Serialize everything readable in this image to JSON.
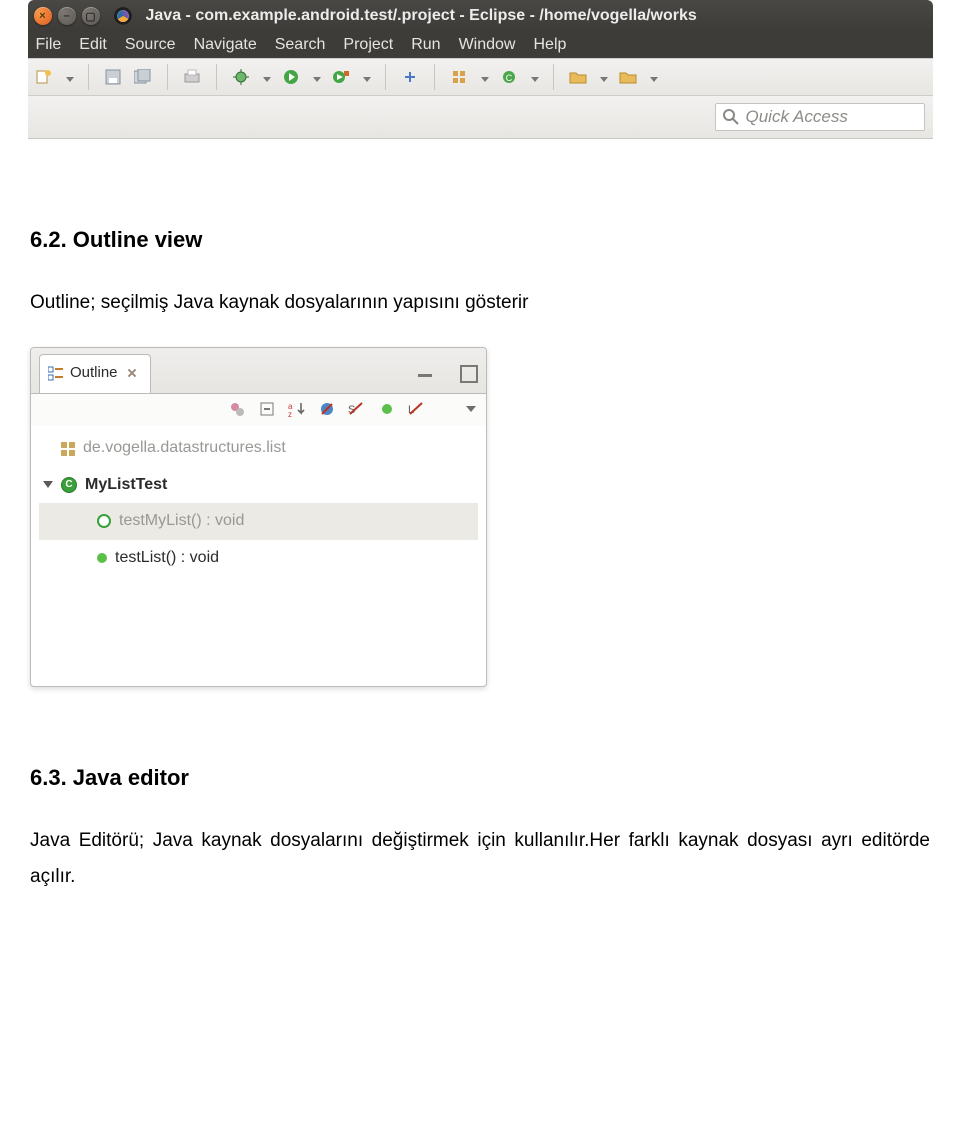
{
  "eclipse": {
    "title": "Java - com.example.android.test/.project - Eclipse - /home/vogella/works",
    "menus": [
      "File",
      "Edit",
      "Source",
      "Navigate",
      "Search",
      "Project",
      "Run",
      "Window",
      "Help"
    ],
    "quick_access_placeholder": "Quick Access"
  },
  "doc": {
    "h1": "6.2. Outline view",
    "p1": "Outline; seçilmiş Java kaynak dosyalarının yapısını gösterir",
    "h2": "6.3. Java editor",
    "p2": "Java Editörü; Java kaynak dosyalarını değiştirmek için kullanılır.Her farklı kaynak dosyası ayrı editörde açılır."
  },
  "outline": {
    "tab_label": "Outline",
    "rows": {
      "pkg": "de.vogella.datastructures.list",
      "cls": "MyListTest",
      "m1": "testMyList() : void",
      "m2": "testList() : void"
    }
  }
}
